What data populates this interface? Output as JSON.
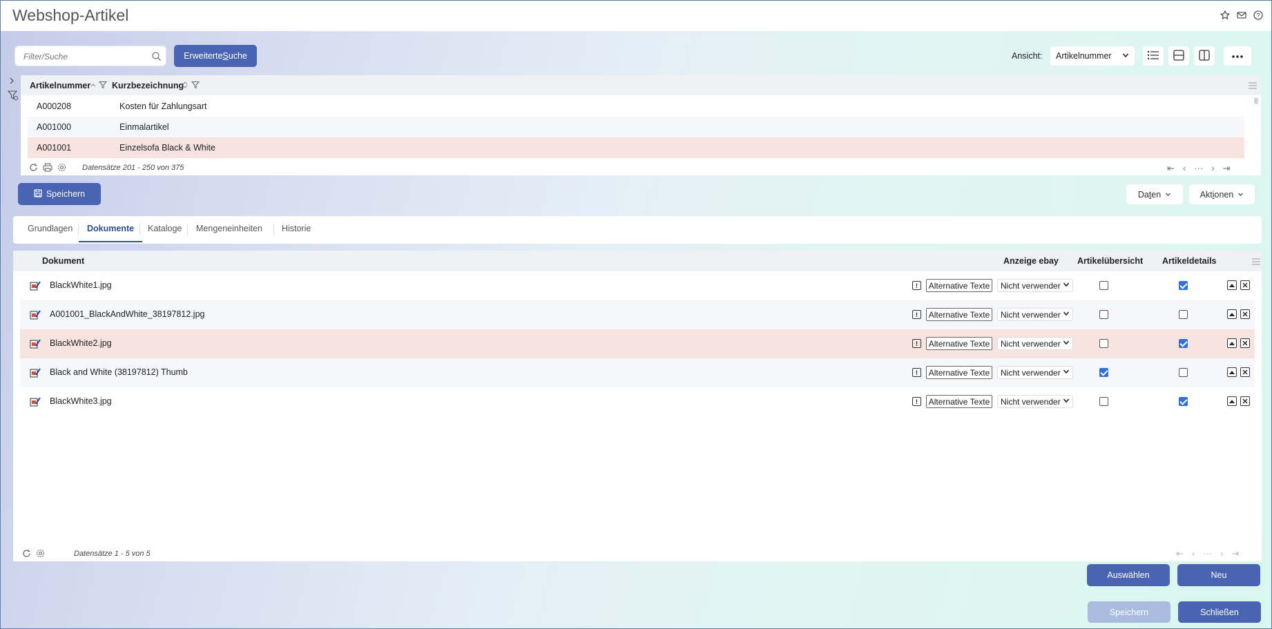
{
  "window": {
    "title": "Webshop-Artikel"
  },
  "search": {
    "placeholder": "Filter/Suche",
    "advanced_label_pre": "Erweiterte ",
    "advanced_label_key": "S",
    "advanced_label_post": "uche"
  },
  "view": {
    "label": "Ansicht:",
    "selected": "Artikelnummer"
  },
  "grid1": {
    "columns": [
      "Artikelnummer",
      "Kurzbezeichnung"
    ],
    "rows": [
      {
        "nr": "A000208",
        "bez": "Kosten für Zahlungsart"
      },
      {
        "nr": "A001000",
        "bez": "Einmalartikel"
      },
      {
        "nr": "A001001",
        "bez": "Einzelsofa Black & White"
      }
    ],
    "footer": "Datensätze 201 - 250 von 375"
  },
  "toolbar": {
    "save_label": "Speichern",
    "data_pre": "Da",
    "data_key": "t",
    "data_post": "en",
    "actions_pre": "Akt",
    "actions_key": "i",
    "actions_post": "onen"
  },
  "tabs": [
    "Grundlagen",
    "Dokumente",
    "Kataloge",
    "Mengeneinheiten",
    "Historie"
  ],
  "grid2": {
    "columns": {
      "doc": "Dokument",
      "ebay": "Anzeige ebay",
      "overview": "Artikelübersicht",
      "details": "Artikeldetails"
    },
    "alt_label": "Alternative Texte",
    "ebay_value": "Nicht verwender",
    "rows": [
      {
        "name": "BlackWhite1.jpg",
        "overview": false,
        "details": true
      },
      {
        "name": "A001001_BlackAndWhite_38197812.jpg",
        "overview": false,
        "details": false
      },
      {
        "name": "BlackWhite2.jpg",
        "overview": false,
        "details": true
      },
      {
        "name": "Black and White (38197812) Thumb",
        "overview": true,
        "details": false
      },
      {
        "name": "BlackWhite3.jpg",
        "overview": false,
        "details": true
      }
    ],
    "footer": "Datensätze 1 - 5 von 5"
  },
  "buttons": {
    "select": "Auswählen",
    "new": "Neu",
    "save": "Speichern",
    "close": "Schließen"
  },
  "colors": {
    "primary": "#4a64b4",
    "selected_row": "#f7e3e0",
    "checkbox_on": "#2f6fdf",
    "disabled": "#a9bce0"
  }
}
